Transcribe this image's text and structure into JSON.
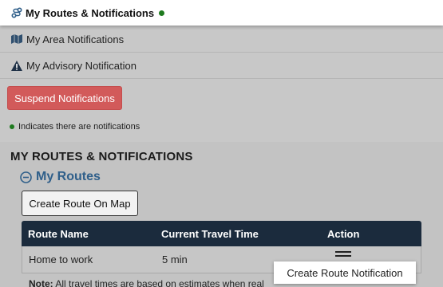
{
  "nav": {
    "active": {
      "label": "My Routes & Notifications",
      "icon": "route-icon",
      "has_notifications": true
    },
    "items": [
      {
        "label": "My Area Notifications",
        "icon": "map-icon"
      },
      {
        "label": "My Advisory Notification",
        "icon": "warning-icon"
      }
    ]
  },
  "suspend_button": {
    "label": "Suspend Notifications"
  },
  "legend": {
    "text": "Indicates there are notifications"
  },
  "section": {
    "title": "MY ROUTES & NOTIFICATIONS",
    "routes_heading": "My Routes",
    "create_on_map_label": "Create Route On Map"
  },
  "table": {
    "columns": [
      "Route Name",
      "Current Travel Time",
      "Action"
    ],
    "rows": [
      {
        "route_name": "Home to work",
        "travel_time": "5 min"
      }
    ]
  },
  "note": {
    "label": "Note:",
    "text": "All travel times are based on estimates when real"
  },
  "action_menu": {
    "items": [
      "Create Route Notification"
    ]
  },
  "colors": {
    "danger": "#d25a5a",
    "header_bg": "#1b2b3d",
    "accent": "#2f5f8a",
    "dot": "#1e7a1e"
  }
}
